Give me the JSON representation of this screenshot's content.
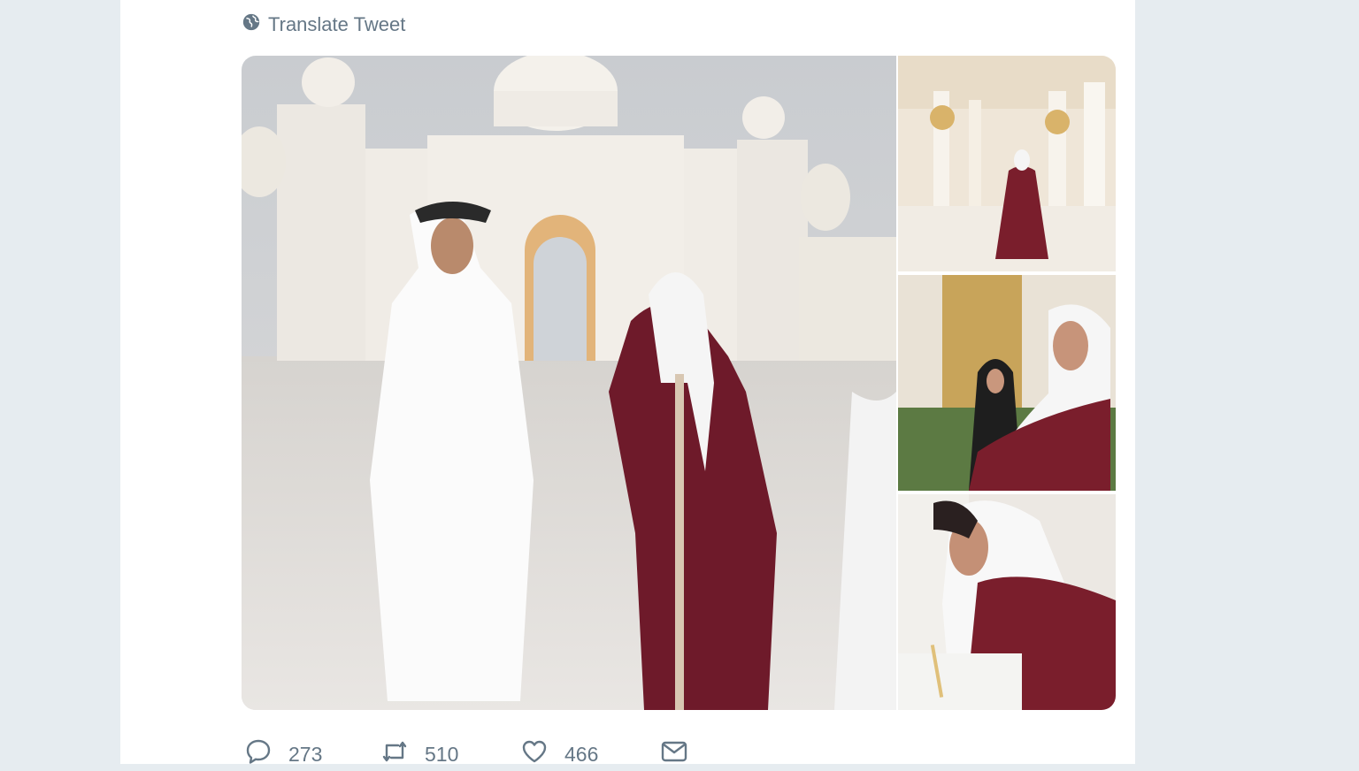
{
  "tweet": {
    "translate_label": "Translate Tweet"
  },
  "actions": {
    "reply_count": "273",
    "retweet_count": "510",
    "like_count": "466"
  },
  "icons": {
    "translate": "globe-icon",
    "reply": "reply-icon",
    "retweet": "retweet-icon",
    "like": "heart-icon",
    "dm": "envelope-icon"
  },
  "colors": {
    "page_background": "#e6ecf0",
    "card_background": "#ffffff",
    "action_gray": "#657786"
  }
}
